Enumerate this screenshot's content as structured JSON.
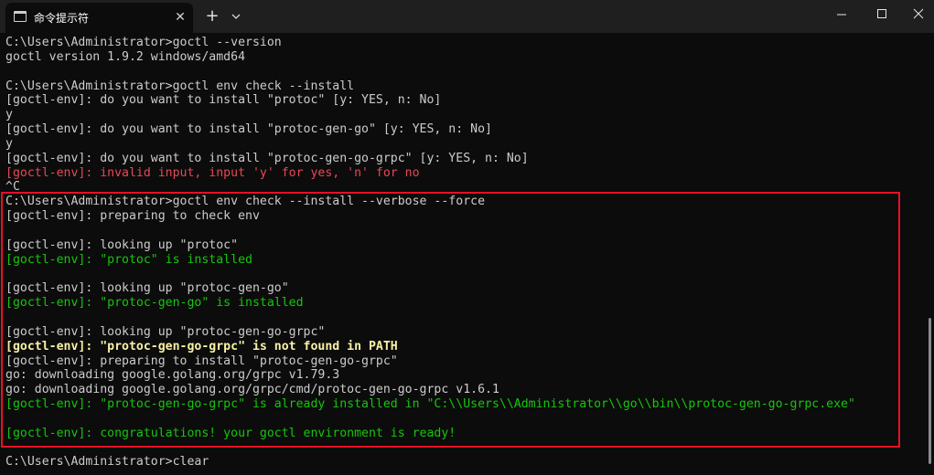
{
  "window": {
    "tab_title": "命令提示符",
    "tab_close_glyph": "✕",
    "new_tab_glyph": "+"
  },
  "colors": {
    "default": "#cccccc",
    "error": "#e74856",
    "success": "#16c60c",
    "warning": "#f9f1a5",
    "highlight_border": "#e81123",
    "background": "#0c0c0c",
    "titlebar": "#1f1f1f"
  },
  "icons": {
    "tab_icon": "terminal-icon",
    "dropdown": "chevron-down-icon",
    "minimize": "minimize-icon",
    "maximize": "maximize-icon",
    "close": "close-icon"
  },
  "terminal": {
    "lines": [
      {
        "text": "C:\\Users\\Administrator>goctl --version",
        "style": "default"
      },
      {
        "text": "goctl version 1.9.2 windows/amd64",
        "style": "default"
      },
      {
        "text": "",
        "style": "default"
      },
      {
        "text": "C:\\Users\\Administrator>goctl env check --install",
        "style": "default"
      },
      {
        "text": "[goctl-env]: do you want to install \"protoc\" [y: YES, n: No]",
        "style": "default"
      },
      {
        "text": "y",
        "style": "default"
      },
      {
        "text": "[goctl-env]: do you want to install \"protoc-gen-go\" [y: YES, n: No]",
        "style": "default"
      },
      {
        "text": "y",
        "style": "default"
      },
      {
        "text": "[goctl-env]: do you want to install \"protoc-gen-go-grpc\" [y: YES, n: No]",
        "style": "default"
      },
      {
        "text": "[goctl-env]: invalid input, input 'y' for yes, 'n' for no",
        "style": "red"
      },
      {
        "text": "^C",
        "style": "default"
      },
      {
        "text": "C:\\Users\\Administrator>goctl env check --install --verbose --force",
        "style": "default"
      },
      {
        "text": "[goctl-env]: preparing to check env",
        "style": "default"
      },
      {
        "text": "",
        "style": "default"
      },
      {
        "text": "[goctl-env]: looking up \"protoc\"",
        "style": "default"
      },
      {
        "text": "[goctl-env]: \"protoc\" is installed",
        "style": "green"
      },
      {
        "text": "",
        "style": "default"
      },
      {
        "text": "[goctl-env]: looking up \"protoc-gen-go\"",
        "style": "default"
      },
      {
        "text": "[goctl-env]: \"protoc-gen-go\" is installed",
        "style": "green"
      },
      {
        "text": "",
        "style": "default"
      },
      {
        "text": "[goctl-env]: looking up \"protoc-gen-go-grpc\"",
        "style": "default"
      },
      {
        "text": "[goctl-env]: \"protoc-gen-go-grpc\" is not found in PATH",
        "style": "yellow"
      },
      {
        "text": "[goctl-env]: preparing to install \"protoc-gen-go-grpc\"",
        "style": "default"
      },
      {
        "text": "go: downloading google.golang.org/grpc v1.79.3",
        "style": "default"
      },
      {
        "text": "go: downloading google.golang.org/grpc/cmd/protoc-gen-go-grpc v1.6.1",
        "style": "default"
      },
      {
        "text": "[goctl-env]: \"protoc-gen-go-grpc\" is already installed in \"C:\\\\Users\\\\Administrator\\\\go\\\\bin\\\\protoc-gen-go-grpc.exe\"",
        "style": "green"
      },
      {
        "text": "",
        "style": "default"
      },
      {
        "text": "[goctl-env]: congratulations! your goctl environment is ready!",
        "style": "green"
      },
      {
        "text": "",
        "style": "default"
      },
      {
        "text": "C:\\Users\\Administrator>clear",
        "style": "default"
      }
    ]
  }
}
